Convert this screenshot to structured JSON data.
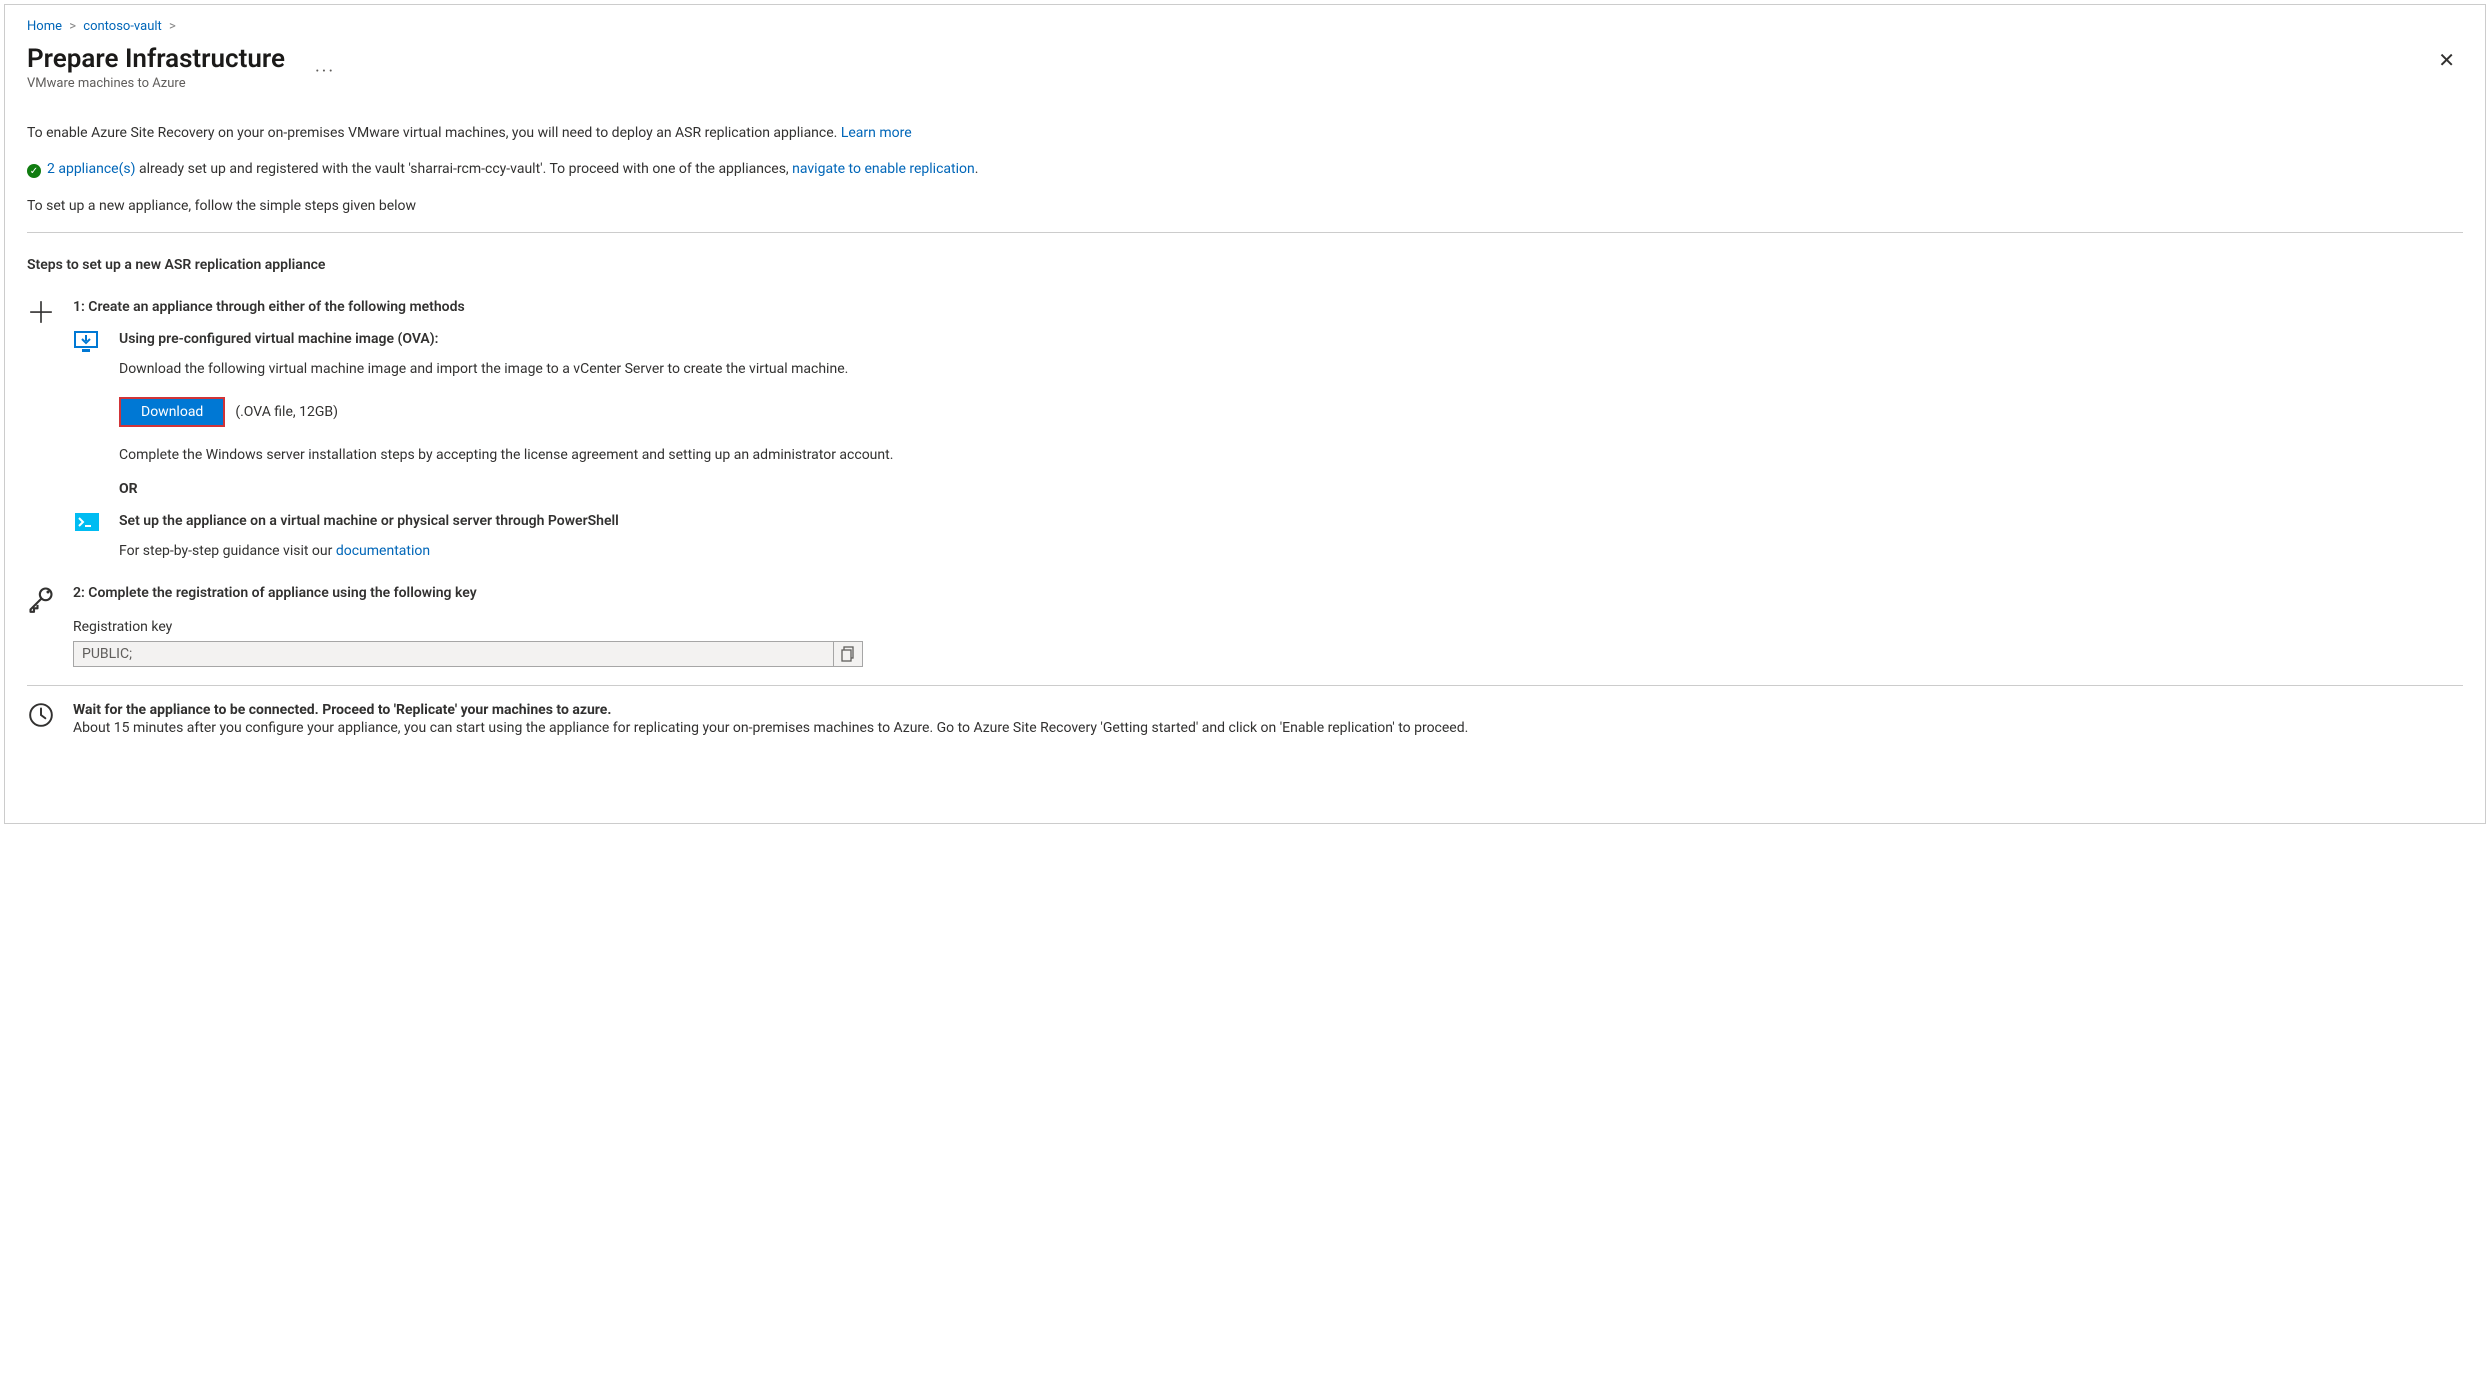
{
  "breadcrumb": {
    "home": "Home",
    "vault": "contoso-vault"
  },
  "header": {
    "title": "Prepare Infrastructure",
    "subtitle": "VMware machines to Azure"
  },
  "intro": {
    "text": "To enable Azure Site Recovery on your on-premises VMware virtual machines, you will need to deploy an ASR replication appliance.",
    "learn_more": "Learn more"
  },
  "status": {
    "appliance_link": "2 appliance(s)",
    "mid_text": " already set up and registered with the vault 'sharrai-rcm-ccy-vault'. To proceed with one of the appliances, ",
    "nav_link": "navigate to enable replication",
    "period": "."
  },
  "setup_note": "To set up a new appliance, follow the simple steps given below",
  "steps_heading": "Steps to set up a new ASR replication appliance",
  "step1": {
    "title": "1: Create an appliance through either of the following methods",
    "method_ova": {
      "title": "Using pre-configured virtual machine image (OVA):",
      "desc": "Download the following virtual machine image and import the image to a vCenter Server to create the virtual machine.",
      "button": "Download",
      "note": "(.OVA file, 12GB)",
      "after": "Complete the Windows server installation steps by accepting the license agreement and setting up an administrator account."
    },
    "or_label": "OR",
    "method_ps": {
      "title": "Set up the appliance on a virtual machine or physical server through PowerShell",
      "desc_prefix": "For step-by-step guidance visit our ",
      "doc_link": "documentation"
    }
  },
  "step2": {
    "title": "2: Complete the registration of appliance using the following key",
    "label": "Registration key",
    "value": "PUBLIC;"
  },
  "wait": {
    "title": "Wait for the appliance to be connected. Proceed to 'Replicate' your machines to azure.",
    "desc": "About 15 minutes after you configure your appliance, you can start using the appliance for replicating your on-premises machines to Azure. Go to Azure Site Recovery 'Getting started' and click on 'Enable replication' to proceed."
  }
}
